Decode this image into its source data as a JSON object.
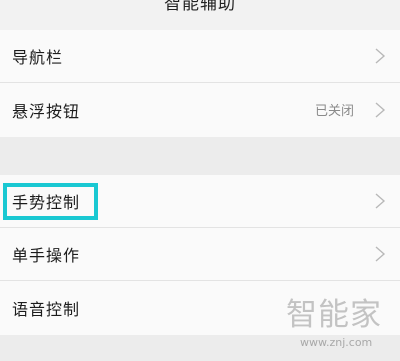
{
  "header": {
    "title": "智能辅助"
  },
  "settings": {
    "group1": [
      {
        "label": "导航栏",
        "value": ""
      },
      {
        "label": "悬浮按钮",
        "value": "已关闭"
      }
    ],
    "group2": [
      {
        "label": "手势控制",
        "value": ""
      },
      {
        "label": "单手操作",
        "value": ""
      },
      {
        "label": "语音控制",
        "value": ""
      }
    ]
  },
  "watermark": {
    "brand": "智能家",
    "url": "www.znj.com"
  },
  "colors": {
    "highlight": "#19c8d2",
    "background": "#ececec",
    "row_background": "#fafafa",
    "chevron": "#b8b8b8"
  },
  "icons": {
    "row_chevron": "chevron-right-icon"
  }
}
